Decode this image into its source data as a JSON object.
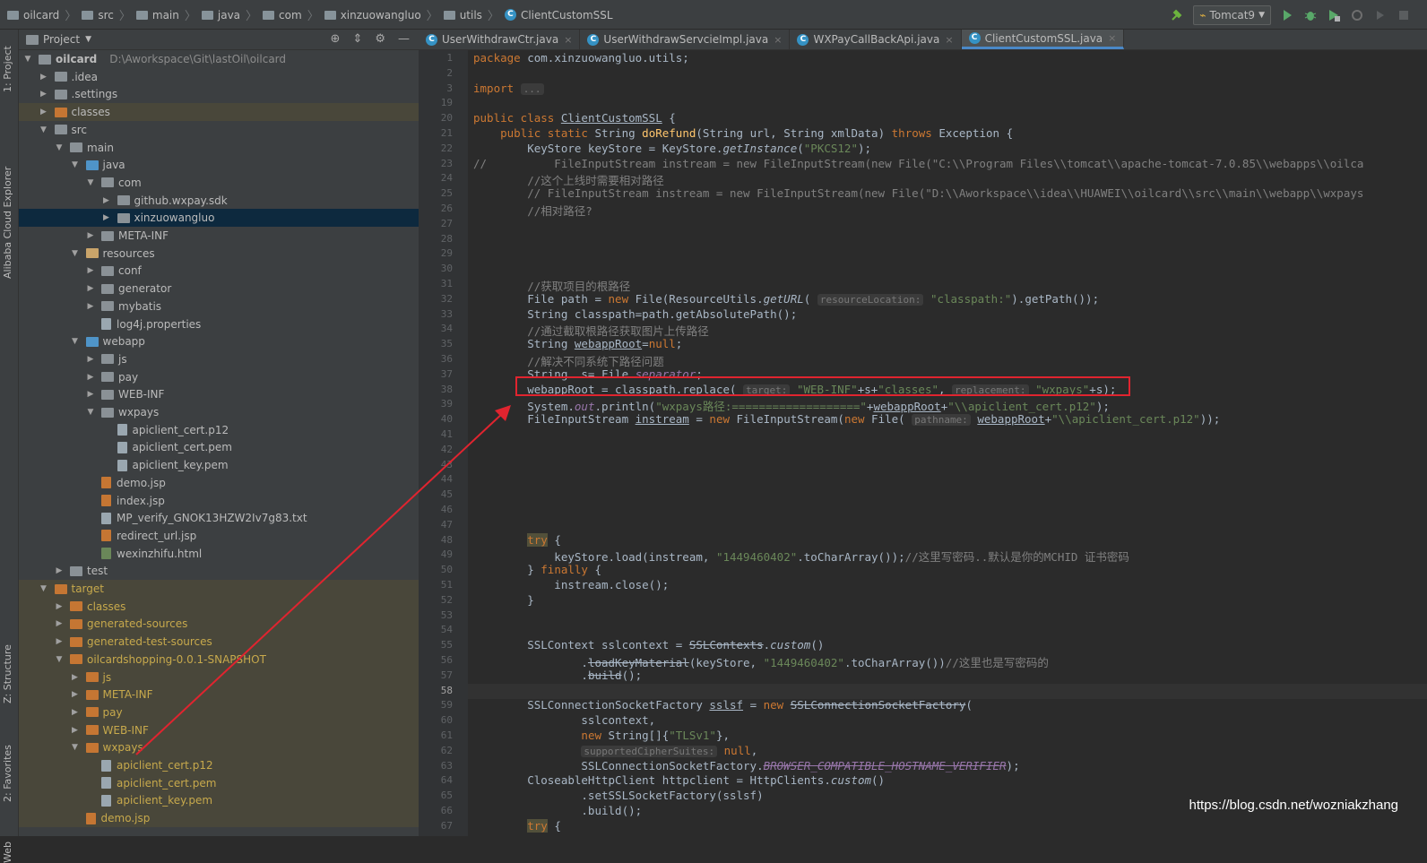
{
  "breadcrumb": [
    "oilcard",
    "src",
    "main",
    "java",
    "com",
    "xinzuowangluo",
    "utils",
    "ClientCustomSSL"
  ],
  "run_config": "Tomcat9",
  "left_strip": {
    "project": "1: Project",
    "alibaba": "Alibaba Cloud Explorer",
    "structure": "Z: Structure",
    "favorites": "2: Favorites",
    "web": "Web"
  },
  "project_panel": {
    "title": "Project",
    "view_arrow": "▼"
  },
  "tree": [
    {
      "indent": 0,
      "arrow": "▼",
      "icon": "g",
      "label": "oilcard",
      "path": "D:\\Aworkspace\\Git\\lastOil\\oilcard",
      "bold": true
    },
    {
      "indent": 1,
      "arrow": "▶",
      "icon": "g",
      "label": ".idea"
    },
    {
      "indent": 1,
      "arrow": "▶",
      "icon": "g",
      "label": ".settings"
    },
    {
      "indent": 1,
      "arrow": "▶",
      "icon": "o",
      "label": "classes",
      "row": "excl"
    },
    {
      "indent": 1,
      "arrow": "▼",
      "icon": "g",
      "label": "src"
    },
    {
      "indent": 2,
      "arrow": "▼",
      "icon": "g",
      "label": "main"
    },
    {
      "indent": 3,
      "arrow": "▼",
      "icon": "b",
      "label": "java"
    },
    {
      "indent": 4,
      "arrow": "▼",
      "icon": "g",
      "label": "com"
    },
    {
      "indent": 5,
      "arrow": "▶",
      "icon": "g",
      "label": "github.wxpay.sdk"
    },
    {
      "indent": 5,
      "arrow": "▶",
      "icon": "g",
      "label": "xinzuowangluo",
      "row": "sel"
    },
    {
      "indent": 4,
      "arrow": "▶",
      "icon": "g",
      "label": "META-INF"
    },
    {
      "indent": 3,
      "arrow": "▼",
      "icon": "y",
      "label": "resources"
    },
    {
      "indent": 4,
      "arrow": "▶",
      "icon": "g",
      "label": "conf"
    },
    {
      "indent": 4,
      "arrow": "▶",
      "icon": "g",
      "label": "generator"
    },
    {
      "indent": 4,
      "arrow": "▶",
      "icon": "g",
      "label": "mybatis"
    },
    {
      "indent": 4,
      "arrow": "",
      "icon": "file",
      "label": "log4j.properties"
    },
    {
      "indent": 3,
      "arrow": "▼",
      "icon": "b",
      "label": "webapp"
    },
    {
      "indent": 4,
      "arrow": "▶",
      "icon": "g",
      "label": "js"
    },
    {
      "indent": 4,
      "arrow": "▶",
      "icon": "g",
      "label": "pay"
    },
    {
      "indent": 4,
      "arrow": "▶",
      "icon": "g",
      "label": "WEB-INF"
    },
    {
      "indent": 4,
      "arrow": "▼",
      "icon": "g",
      "label": "wxpays"
    },
    {
      "indent": 5,
      "arrow": "",
      "icon": "file",
      "label": "apiclient_cert.p12"
    },
    {
      "indent": 5,
      "arrow": "",
      "icon": "file",
      "label": "apiclient_cert.pem"
    },
    {
      "indent": 5,
      "arrow": "",
      "icon": "file",
      "label": "apiclient_key.pem"
    },
    {
      "indent": 4,
      "arrow": "",
      "icon": "jsp",
      "label": "demo.jsp"
    },
    {
      "indent": 4,
      "arrow": "",
      "icon": "jsp",
      "label": "index.jsp"
    },
    {
      "indent": 4,
      "arrow": "",
      "icon": "file",
      "label": "MP_verify_GNOK13HZW2Iv7g83.txt"
    },
    {
      "indent": 4,
      "arrow": "",
      "icon": "jsp",
      "label": "redirect_url.jsp"
    },
    {
      "indent": 4,
      "arrow": "",
      "icon": "html",
      "label": "wexinzhifu.html"
    },
    {
      "indent": 2,
      "arrow": "▶",
      "icon": "g",
      "label": "test"
    },
    {
      "indent": 1,
      "arrow": "▼",
      "icon": "o",
      "label": "target",
      "row": "excl",
      "yellow": true
    },
    {
      "indent": 2,
      "arrow": "▶",
      "icon": "o",
      "label": "classes",
      "row": "excl",
      "yellow": true
    },
    {
      "indent": 2,
      "arrow": "▶",
      "icon": "o",
      "label": "generated-sources",
      "row": "excl",
      "yellow": true
    },
    {
      "indent": 2,
      "arrow": "▶",
      "icon": "o",
      "label": "generated-test-sources",
      "row": "excl",
      "yellow": true
    },
    {
      "indent": 2,
      "arrow": "▼",
      "icon": "o",
      "label": "oilcardshopping-0.0.1-SNAPSHOT",
      "row": "excl",
      "yellow": true
    },
    {
      "indent": 3,
      "arrow": "▶",
      "icon": "o",
      "label": "js",
      "row": "excl",
      "yellow": true
    },
    {
      "indent": 3,
      "arrow": "▶",
      "icon": "o",
      "label": "META-INF",
      "row": "excl",
      "yellow": true
    },
    {
      "indent": 3,
      "arrow": "▶",
      "icon": "o",
      "label": "pay",
      "row": "excl",
      "yellow": true
    },
    {
      "indent": 3,
      "arrow": "▶",
      "icon": "o",
      "label": "WEB-INF",
      "row": "excl",
      "yellow": true
    },
    {
      "indent": 3,
      "arrow": "▼",
      "icon": "o",
      "label": "wxpays",
      "row": "excl",
      "yellow": true
    },
    {
      "indent": 4,
      "arrow": "",
      "icon": "file",
      "label": "apiclient_cert.p12",
      "row": "excl",
      "yellow": true
    },
    {
      "indent": 4,
      "arrow": "",
      "icon": "file",
      "label": "apiclient_cert.pem",
      "row": "excl",
      "yellow": true
    },
    {
      "indent": 4,
      "arrow": "",
      "icon": "file",
      "label": "apiclient_key.pem",
      "row": "excl",
      "yellow": true
    },
    {
      "indent": 3,
      "arrow": "",
      "icon": "jsp",
      "label": "demo.jsp",
      "row": "excl",
      "yellow": true
    }
  ],
  "tabs": [
    {
      "label": "UserWithdrawCtr.java",
      "active": false
    },
    {
      "label": "UserWithdrawServcieImpl.java",
      "active": false
    },
    {
      "label": "WXPayCallBackApi.java",
      "active": false
    },
    {
      "label": "ClientCustomSSL.java",
      "active": true
    }
  ],
  "code_lines": [
    {
      "n": "1",
      "html": "<span class='kw'>package</span> com.xinzuowangluo.utils;"
    },
    {
      "n": "2",
      "html": ""
    },
    {
      "n": "3",
      "html": "<span class='kw'>import</span> <span class='hint'>...</span>"
    },
    {
      "n": "19",
      "html": ""
    },
    {
      "n": "20",
      "html": "<span class='kw'>public class</span> <span class='ul'>ClientCustomSSL</span> {"
    },
    {
      "n": "21",
      "html": "    <span class='kw'>public static</span> String <span class='mt'>doRefund</span>(String url, String xmlData) <span class='kw'>throws</span> Exception {"
    },
    {
      "n": "22",
      "html": "        KeyStore keyStore = KeyStore.<span class='it'>getInstance</span>(<span class='st'>\"PKCS12\"</span>);"
    },
    {
      "n": "23",
      "html": "<span class='cm'>//          FileInputStream instream = new FileInputStream(new File(\"C:\\\\Program Files\\\\tomcat\\\\apache-tomcat-7.0.85\\\\webapps\\\\oilca</span>"
    },
    {
      "n": "24",
      "html": "        <span class='cm'>//这个上线时需要相对路径</span>"
    },
    {
      "n": "25",
      "html": "        <span class='cm'>// FileInputStream instream = new FileInputStream(new File(\"D:\\\\Aworkspace\\\\idea\\\\HUAWEI\\\\oilcard\\\\src\\\\main\\\\webapp\\\\wxpays</span>"
    },
    {
      "n": "26",
      "html": "        <span class='cm'>//相对路径?</span>"
    },
    {
      "n": "27",
      "html": ""
    },
    {
      "n": "28",
      "html": ""
    },
    {
      "n": "29",
      "html": ""
    },
    {
      "n": "30",
      "html": ""
    },
    {
      "n": "31",
      "html": "        <span class='cm'>//获取项目的根路径</span>"
    },
    {
      "n": "32",
      "html": "        File path = <span class='kw'>new</span> File(ResourceUtils.<span class='it'>getURL</span>( <span class='hint'>resourceLocation:</span> <span class='st'>\"classpath:\"</span>).getPath());"
    },
    {
      "n": "33",
      "html": "        String classpath=path.getAbsolutePath();"
    },
    {
      "n": "34",
      "html": "        <span class='cm'>//通过截取根路径获取图片上传路径</span>"
    },
    {
      "n": "35",
      "html": "        String <span class='ul'>webappRoot</span>=<span class='kw'>null</span>;"
    },
    {
      "n": "36",
      "html": "        <span class='cm'>//解决不同系统下路径问题</span>"
    },
    {
      "n": "37",
      "html": "        String  s= File.<span class='fld'>separator</span>;"
    },
    {
      "n": "38",
      "html": "        <span class='ul'>webappRoot</span> = classpath.replace( <span class='hint'>target:</span> <span class='st'>\"WEB-INF\"</span>+s+<span class='st'>\"classes\"</span>, <span class='hint'>replacement:</span> <span class='st'>\"wxpays\"</span>+s);"
    },
    {
      "n": "39",
      "html": "        System.<span class='fld'>out</span>.println(<span class='st'>\"wxpays路径:===================\"</span>+<span class='ul'>webappRoot</span>+<span class='st'>\"\\\\apiclient_cert.p12\"</span>);"
    },
    {
      "n": "40",
      "html": "        FileInputStream <span class='ul'>instream</span> = <span class='kw'>new</span> FileInputStream(<span class='kw'>new</span> File( <span class='hint'>pathname:</span> <span class='ul'>webappRoot</span>+<span class='st'>\"\\\\apiclient_cert.p12\"</span>));"
    },
    {
      "n": "41",
      "html": ""
    },
    {
      "n": "42",
      "html": ""
    },
    {
      "n": "43",
      "html": ""
    },
    {
      "n": "44",
      "html": ""
    },
    {
      "n": "45",
      "html": ""
    },
    {
      "n": "46",
      "html": ""
    },
    {
      "n": "47",
      "html": ""
    },
    {
      "n": "48",
      "html": "        <span class='kw hl'>try</span> {"
    },
    {
      "n": "49",
      "html": "            keyStore.load(instream, <span class='st'>\"1449460402\"</span>.toCharArray());<span class='cm'>//这里写密码..默认是你的MCHID 证书密码</span>"
    },
    {
      "n": "50",
      "html": "        } <span class='kw'>finally</span> {"
    },
    {
      "n": "51",
      "html": "            instream.close();"
    },
    {
      "n": "52",
      "html": "        }"
    },
    {
      "n": "53",
      "html": ""
    },
    {
      "n": "54",
      "html": ""
    },
    {
      "n": "55",
      "html": "        SSLContext sslcontext = <span class='strike'>SSLContexts</span>.<span class='it'>custom</span>()"
    },
    {
      "n": "56",
      "html": "                .<span class='strike'>loadKeyMaterial</span>(keyStore, <span class='st'>\"1449460402\"</span>.toCharArray())<span class='cm'>//这里也是写密码的</span>"
    },
    {
      "n": "57",
      "html": "                .<span class='strike'>build</span>();"
    },
    {
      "n": "58",
      "html": ""
    },
    {
      "n": "59",
      "html": "        SSLConnectionSocketFactory <span class='ul'>sslsf</span> = <span class='kw'>new</span> <span class='strike'>SSLConnectionSocketFactory</span>("
    },
    {
      "n": "60",
      "html": "                sslcontext,"
    },
    {
      "n": "61",
      "html": "                <span class='kw'>new</span> String[]{<span class='st'>\"TLSv1\"</span>},"
    },
    {
      "n": "62",
      "html": "                <span class='hint'>supportedCipherSuites:</span> <span class='kw'>null</span>,"
    },
    {
      "n": "63",
      "html": "                SSLConnectionSocketFactory.<span class='fld strike'>BROWSER_COMPATIBLE_HOSTNAME_VERIFIER</span>);"
    },
    {
      "n": "64",
      "html": "        CloseableHttpClient httpclient = HttpClients.<span class='it'>custom</span>()"
    },
    {
      "n": "65",
      "html": "                .setSSLSocketFactory(sslsf)"
    },
    {
      "n": "66",
      "html": "                .build();"
    },
    {
      "n": "67",
      "html": "        <span class='kw hl'>try</span> {"
    }
  ],
  "current_line": "58",
  "watermark": "https://blog.csdn.net/wozniakzhang",
  "colors": {
    "accent": "#4a88c7",
    "annotation": "#e0242f"
  }
}
